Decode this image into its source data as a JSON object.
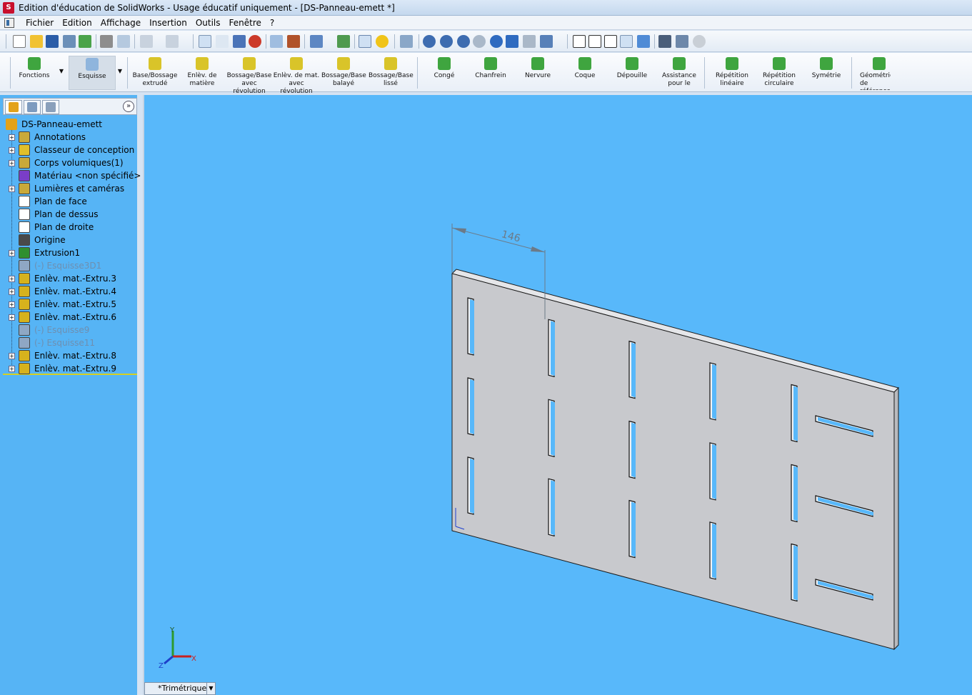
{
  "window": {
    "title": "Edition d'éducation de SolidWorks - Usage éducatif uniquement - [DS-Panneau-emett *]",
    "app_icon": "S"
  },
  "menu": {
    "items": [
      "Fichier",
      "Edition",
      "Affichage",
      "Insertion",
      "Outils",
      "Fenêtre",
      "?"
    ]
  },
  "command_manager": {
    "items": [
      {
        "label": "Fonctions",
        "icon": "features-icon"
      },
      {
        "label": "Esquisse",
        "icon": "sketch-icon"
      },
      {
        "label": "Base/Bossage extrudé",
        "icon": "extruded-boss-icon"
      },
      {
        "label": "Enlèv. de matière",
        "icon": "extruded-cut-icon"
      },
      {
        "label": "Bossage/Base avec révolution",
        "icon": "revolved-boss-icon"
      },
      {
        "label": "Enlèv. de mat. avec révolution",
        "icon": "revolved-cut-icon"
      },
      {
        "label": "Bossage/Base balayé",
        "icon": "swept-boss-icon"
      },
      {
        "label": "Bossage/Base lissé",
        "icon": "lofted-boss-icon"
      },
      {
        "label": "Congé",
        "icon": "fillet-icon"
      },
      {
        "label": "Chanfrein",
        "icon": "chamfer-icon"
      },
      {
        "label": "Nervure",
        "icon": "rib-icon"
      },
      {
        "label": "Coque",
        "icon": "shell-icon"
      },
      {
        "label": "Dépouille",
        "icon": "draft-icon"
      },
      {
        "label": "Assistance pour le",
        "icon": "hole-wizard-icon"
      },
      {
        "label": "Répétition linéaire",
        "icon": "linear-pattern-icon"
      },
      {
        "label": "Répétition circulaire",
        "icon": "circular-pattern-icon"
      },
      {
        "label": "Symétrie",
        "icon": "mirror-icon"
      },
      {
        "label": "Géométrie de référence",
        "icon": "reference-geometry-icon"
      }
    ]
  },
  "feature_tree": {
    "root": "DS-Panneau-emett",
    "nodes": [
      {
        "label": "Annotations",
        "expandable": true,
        "suppressed": false
      },
      {
        "label": "Classeur de conception",
        "expandable": true,
        "suppressed": false
      },
      {
        "label": "Corps volumiques(1)",
        "expandable": true,
        "suppressed": false
      },
      {
        "label": "Matériau <non spécifié>",
        "expandable": false,
        "suppressed": false
      },
      {
        "label": "Lumières et caméras",
        "expandable": true,
        "suppressed": false
      },
      {
        "label": "Plan de face",
        "expandable": false,
        "suppressed": false
      },
      {
        "label": "Plan de dessus",
        "expandable": false,
        "suppressed": false
      },
      {
        "label": "Plan de droite",
        "expandable": false,
        "suppressed": false
      },
      {
        "label": "Origine",
        "expandable": false,
        "suppressed": false
      },
      {
        "label": "Extrusion1",
        "expandable": true,
        "suppressed": false
      },
      {
        "label": "(-) Esquisse3D1",
        "expandable": false,
        "suppressed": true
      },
      {
        "label": "Enlèv. mat.-Extru.3",
        "expandable": true,
        "suppressed": false
      },
      {
        "label": "Enlèv. mat.-Extru.4",
        "expandable": true,
        "suppressed": false
      },
      {
        "label": "Enlèv. mat.-Extru.5",
        "expandable": true,
        "suppressed": false
      },
      {
        "label": "Enlèv. mat.-Extru.6",
        "expandable": true,
        "suppressed": false
      },
      {
        "label": "(-) Esquisse9",
        "expandable": false,
        "suppressed": true
      },
      {
        "label": "(-) Esquisse11",
        "expandable": false,
        "suppressed": true
      },
      {
        "label": "Enlèv. mat.-Extru.8",
        "expandable": true,
        "suppressed": false
      },
      {
        "label": "Enlèv. mat.-Extru.9",
        "expandable": true,
        "suppressed": false
      }
    ]
  },
  "viewport": {
    "dimension_label": "146",
    "view_orientation": "*Trimétrique",
    "triad": {
      "x": "X",
      "y": "Y",
      "z": "Z"
    },
    "background_color": "#58b8fa",
    "part_color": "#c8c9cd"
  },
  "panel": {
    "expand_glyph": "»",
    "plus_glyph": "+",
    "dropdown_glyph": "▼"
  }
}
